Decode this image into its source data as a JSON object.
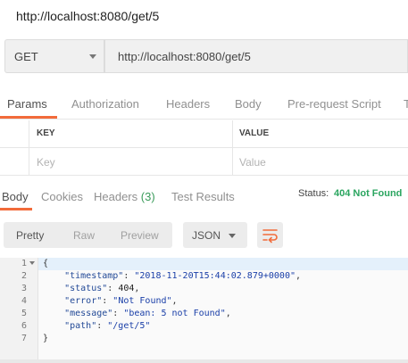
{
  "title_url": "http://localhost:8080/get/5",
  "request": {
    "method": "GET",
    "url": "http://localhost:8080/get/5"
  },
  "request_tabs": [
    "Params",
    "Authorization",
    "Headers",
    "Body",
    "Pre-request Script",
    "T"
  ],
  "params_table": {
    "columns": [
      "KEY",
      "VALUE"
    ],
    "placeholders": [
      "Key",
      "Value"
    ]
  },
  "response_tabs": {
    "body": "Body",
    "cookies": "Cookies",
    "headers": "Headers",
    "headers_count": "(3)",
    "tests": "Test Results"
  },
  "status": {
    "label": "Status:",
    "value": "404 Not Found",
    "color": "#2aa55f"
  },
  "view_modes": [
    "Pretty",
    "Raw",
    "Preview"
  ],
  "format": "JSON",
  "accent": "#f26b3a",
  "line_numbers": [
    "1",
    "2",
    "3",
    "4",
    "5",
    "6",
    "7"
  ],
  "json_lines": [
    {
      "key": "",
      "val": "",
      "text": "{"
    },
    {
      "key": "\"timestamp\"",
      "val": "\"2018-11-20T15:44:02.879+0000\"",
      "trail": ","
    },
    {
      "key": "\"status\"",
      "val": "404",
      "trail": ","
    },
    {
      "key": "\"error\"",
      "val": "\"Not Found\"",
      "trail": ","
    },
    {
      "key": "\"message\"",
      "val": "\"bean: 5 not Found\"",
      "trail": ","
    },
    {
      "key": "\"path\"",
      "val": "\"/get/5\"",
      "trail": ""
    },
    {
      "key": "",
      "val": "",
      "text": "}"
    }
  ]
}
